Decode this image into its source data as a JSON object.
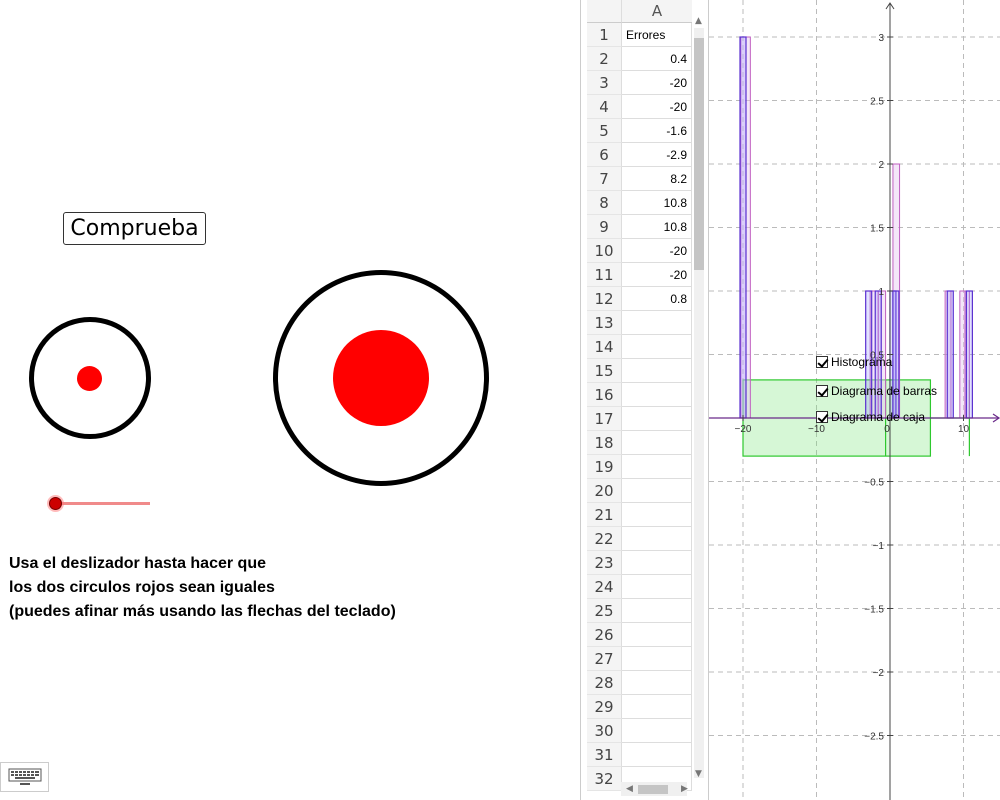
{
  "left": {
    "check_button": "Comprueba",
    "instructions": [
      "Usa el deslizador hasta hacer que",
      "los dos circulos rojos sean iguales",
      "(puedes afinar más usando las flechas del teclado)"
    ],
    "slider_value": 0.0
  },
  "sheet": {
    "column_header": "A",
    "rows": [
      {
        "n": "1",
        "v": "Errores"
      },
      {
        "n": "2",
        "v": "0.4"
      },
      {
        "n": "3",
        "v": "-20"
      },
      {
        "n": "4",
        "v": "-20"
      },
      {
        "n": "5",
        "v": "-1.6"
      },
      {
        "n": "6",
        "v": "-2.9"
      },
      {
        "n": "7",
        "v": "8.2"
      },
      {
        "n": "8",
        "v": "10.8"
      },
      {
        "n": "9",
        "v": "10.8"
      },
      {
        "n": "10",
        "v": "-20"
      },
      {
        "n": "11",
        "v": "-20"
      },
      {
        "n": "12",
        "v": "0.8"
      },
      {
        "n": "13",
        "v": ""
      },
      {
        "n": "14",
        "v": ""
      },
      {
        "n": "15",
        "v": ""
      },
      {
        "n": "16",
        "v": ""
      },
      {
        "n": "17",
        "v": ""
      },
      {
        "n": "18",
        "v": ""
      },
      {
        "n": "19",
        "v": ""
      },
      {
        "n": "20",
        "v": ""
      },
      {
        "n": "21",
        "v": ""
      },
      {
        "n": "22",
        "v": ""
      },
      {
        "n": "23",
        "v": ""
      },
      {
        "n": "24",
        "v": ""
      },
      {
        "n": "25",
        "v": ""
      },
      {
        "n": "26",
        "v": ""
      },
      {
        "n": "27",
        "v": ""
      },
      {
        "n": "28",
        "v": ""
      },
      {
        "n": "29",
        "v": ""
      },
      {
        "n": "30",
        "v": ""
      },
      {
        "n": "31",
        "v": ""
      },
      {
        "n": "32",
        "v": ""
      }
    ]
  },
  "graph": {
    "checkboxes": [
      {
        "label": "Histograma",
        "checked": true
      },
      {
        "label": "Diagrama de barras",
        "checked": true
      },
      {
        "label": "Diagrama de caja",
        "checked": true
      }
    ]
  },
  "chart_data": {
    "type": "bar",
    "xlim": [
      -23.5,
      13.5
    ],
    "ylim": [
      -3.0,
      3.3
    ],
    "x_ticks": [
      -20,
      -10,
      0,
      10
    ],
    "x_tick_labels": [
      "−20",
      "−10",
      "0",
      "10"
    ],
    "y_ticks": [
      -2.5,
      -2,
      -1.5,
      -1,
      -0.5,
      0.5,
      1,
      1.5,
      2,
      2.5,
      3
    ],
    "y_tick_labels": [
      "−2.5",
      "−2",
      "−1.5",
      "−1",
      "−0.5",
      "0.5",
      "1",
      "1.5",
      "2",
      "2.5",
      "3"
    ],
    "bar_diagram": {
      "color": "#5a2fd0",
      "x": [
        -20,
        -1.6,
        -2.9,
        0.4,
        0.8,
        8.2,
        10.8
      ],
      "values": [
        3,
        1,
        1,
        1,
        1,
        1,
        1
      ]
    },
    "histogram": {
      "color": "#c060c0",
      "bins": [
        [
          -20.3,
          -19.0,
          3
        ],
        [
          -2.7,
          -1.6,
          1
        ],
        [
          -1.6,
          -0.6,
          1
        ],
        [
          0.4,
          1.3,
          2
        ],
        [
          7.5,
          8.3,
          1
        ],
        [
          9.5,
          10.2,
          1
        ],
        [
          10.2,
          10.8,
          1
        ]
      ]
    },
    "boxplot": {
      "color": "#2ec82e",
      "min": -20,
      "q1": -20,
      "median": -0.6,
      "q3": 5.5,
      "max": 10.8,
      "center_y": 0.0
    },
    "grid": true
  }
}
